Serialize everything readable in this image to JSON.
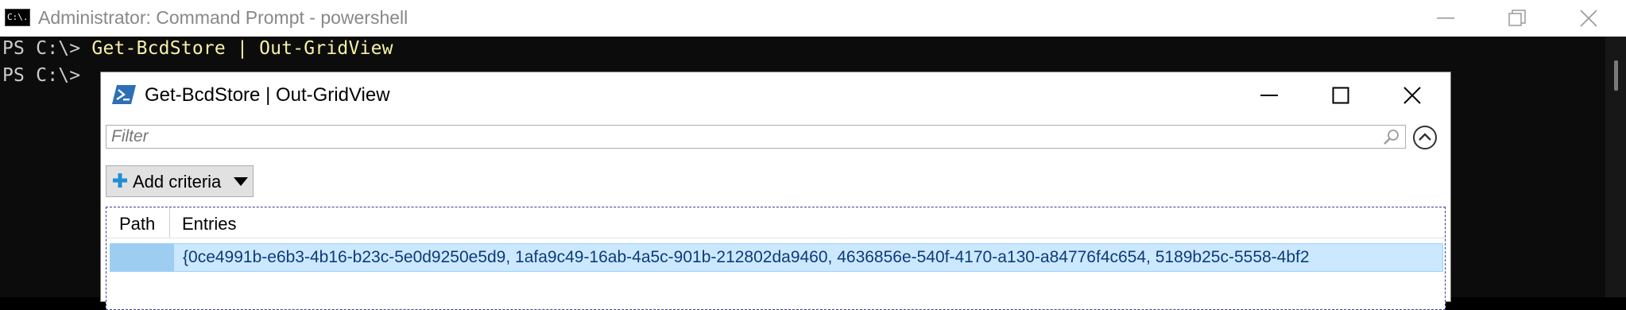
{
  "console": {
    "title": "Administrator: Command Prompt - powershell",
    "icon_text": "C:\\.",
    "lines": [
      {
        "prompt": "PS C:\\> ",
        "command": "Get-BcdStore | Out-GridView"
      },
      {
        "prompt": "PS C:\\> ",
        "command": ""
      }
    ],
    "caption_buttons": [
      "minimize-icon",
      "restore-icon",
      "close-icon"
    ]
  },
  "gridview": {
    "title": "Get-BcdStore | Out-GridView",
    "caption_buttons": [
      "minimize-icon",
      "maximize-icon",
      "close-icon"
    ],
    "filter": {
      "placeholder": "Filter",
      "value": ""
    },
    "add_criteria_label": "Add criteria",
    "columns": [
      "Path",
      "Entries"
    ],
    "rows": [
      {
        "path": "",
        "entries": "{0ce4991b-e6b3-4b16-b23c-5e0d9250e5d9, 1afa9c49-16ab-4a5c-901b-212802da9460, 4636856e-540f-4170-a130-a84776f4c654, 5189b25c-5558-4bf2"
      }
    ]
  },
  "colors": {
    "console_bg": "#0c0c0c",
    "console_text": "#cccccc",
    "command_text": "#f9f1a5",
    "selection_bg": "#cce8ff",
    "selection_border": "#99d1ff",
    "ps_icon_blue": "#2c6fb7",
    "plus_blue": "#1e90d6"
  }
}
